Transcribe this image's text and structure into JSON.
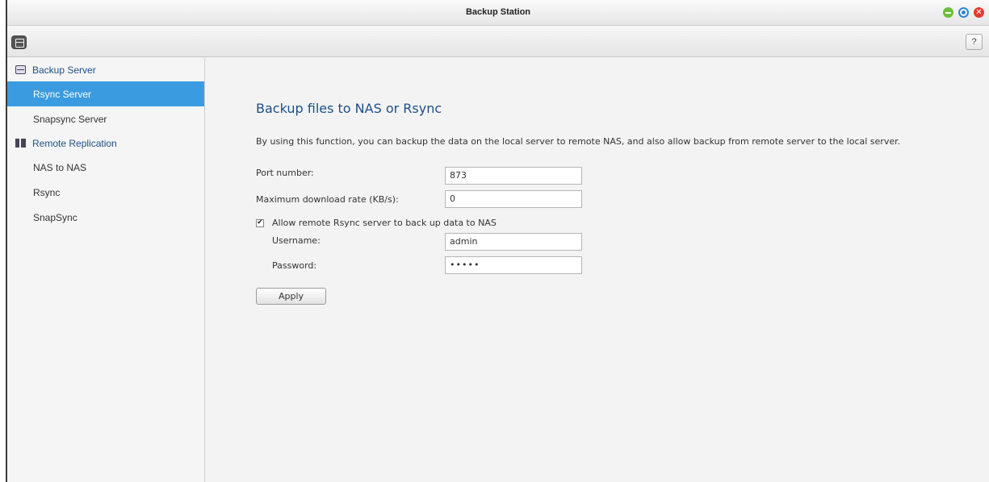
{
  "window": {
    "title": "Backup Station",
    "help_label": "?"
  },
  "sidebar": {
    "groups": [
      {
        "label": "Backup Server",
        "icon": "server-icon",
        "items": [
          {
            "label": "Rsync Server",
            "active": true
          },
          {
            "label": "Snapsync Server",
            "active": false
          }
        ]
      },
      {
        "label": "Remote Replication",
        "icon": "replication-icon",
        "items": [
          {
            "label": "NAS to NAS",
            "active": false
          },
          {
            "label": "Rsync",
            "active": false
          },
          {
            "label": "SnapSync",
            "active": false
          }
        ]
      }
    ]
  },
  "main": {
    "title": "Backup files to NAS or Rsync",
    "description": "By using this function, you can backup the data on the local server to remote NAS, and also allow backup from remote server to the local server.",
    "port": {
      "label": "Port number:",
      "value": "873"
    },
    "max_rate": {
      "label": "Maximum download rate (KB/s):",
      "value": "0"
    },
    "allow_remote": {
      "label": "Allow remote Rsync server to back up data to NAS",
      "checked": true
    },
    "username": {
      "label": "Username:",
      "value": "admin"
    },
    "password": {
      "label": "Password:",
      "value": "•••••"
    },
    "apply_label": "Apply"
  },
  "colors": {
    "accent": "#3a9be0",
    "heading": "#1d4f87",
    "minimize": "#6cbf3a",
    "maximize": "#2a85d8",
    "close": "#e23b2f"
  }
}
